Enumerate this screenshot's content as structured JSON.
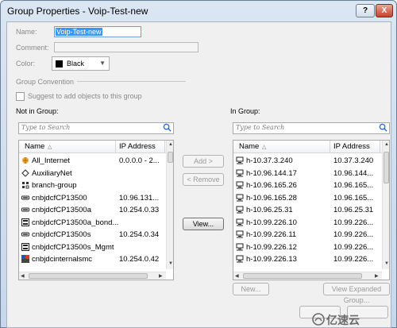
{
  "window": {
    "title": "Group Properties - Voip-Test-new",
    "help_label": "?",
    "close_label": "X"
  },
  "form": {
    "name_label": "Name:",
    "name_value": "Voip-Test-new",
    "comment_label": "Comment:",
    "comment_value": "",
    "color_label": "Color:",
    "color_value": "Black",
    "color_swatch": "#000000",
    "convention_label": "Group Convention",
    "suggest_label": "Suggest to add objects to this group"
  },
  "not_in_group": {
    "label": "Not in Group:",
    "search_placeholder": "Type to Search",
    "col_name": "Name",
    "col_ip": "IP Address",
    "rows": [
      {
        "icon": "internet-icon",
        "name": "All_Internet",
        "ip": "0.0.0.0 - 2..."
      },
      {
        "icon": "network-object-icon",
        "name": "AuxiliaryNet",
        "ip": ""
      },
      {
        "icon": "group-icon",
        "name": "branch-group",
        "ip": ""
      },
      {
        "icon": "gateway-icon",
        "name": "cnbjdcfCP13500",
        "ip": "10.96.131..."
      },
      {
        "icon": "gateway-icon",
        "name": "cnbjdcfCP13500a",
        "ip": "10.254.0.33"
      },
      {
        "icon": "cluster-icon",
        "name": "cnbjdcfCP13500a_bond...",
        "ip": ""
      },
      {
        "icon": "gateway-icon",
        "name": "cnbjdcfCP13500s",
        "ip": "10.254.0.34"
      },
      {
        "icon": "cluster-icon",
        "name": "cnbjdcfCP13500s_Mgmt",
        "ip": ""
      },
      {
        "icon": "internal-icon",
        "name": "cnbjdcinternalsmc",
        "ip": "10.254.0.42"
      }
    ]
  },
  "in_group": {
    "label": "In Group:",
    "search_placeholder": "Type to Search",
    "col_name": "Name",
    "col_ip": "IP Address",
    "rows": [
      {
        "icon": "host-icon",
        "name": "h-10.37.3.240",
        "ip": "10.37.3.240"
      },
      {
        "icon": "host-icon",
        "name": "h-10.96.144.17",
        "ip": "10.96.144..."
      },
      {
        "icon": "host-icon",
        "name": "h-10.96.165.26",
        "ip": "10.96.165..."
      },
      {
        "icon": "host-icon",
        "name": "h-10.96.165.28",
        "ip": "10.96.165..."
      },
      {
        "icon": "host-icon",
        "name": "h-10.96.25.31",
        "ip": "10.96.25.31"
      },
      {
        "icon": "host-icon",
        "name": "h-10.99.226.10",
        "ip": "10.99.226..."
      },
      {
        "icon": "host-icon",
        "name": "h-10.99.226.11",
        "ip": "10.99.226..."
      },
      {
        "icon": "host-icon",
        "name": "h-10.99.226.12",
        "ip": "10.99.226..."
      },
      {
        "icon": "host-icon",
        "name": "h-10.99.226.13",
        "ip": "10.99.226..."
      }
    ]
  },
  "buttons": {
    "add": "Add >",
    "remove": "< Remove",
    "view": "View...",
    "new": "New...",
    "view_expanded": "View Expanded Group...",
    "ok": "",
    "cancel": ""
  },
  "watermark": "亿速云"
}
